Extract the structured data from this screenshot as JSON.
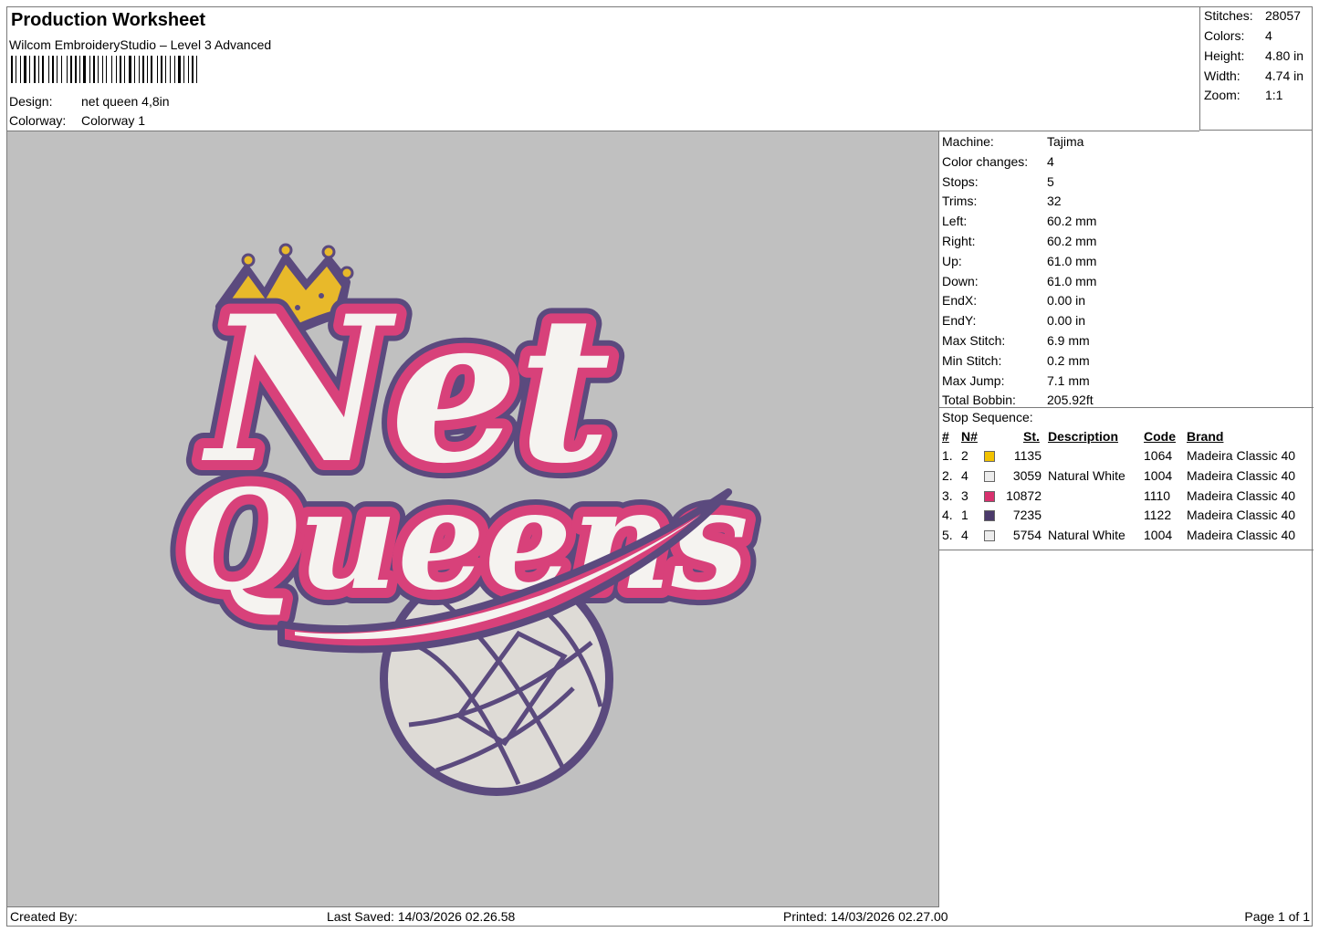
{
  "header": {
    "title": "Production Worksheet",
    "software": "Wilcom EmbroideryStudio – Level 3 Advanced",
    "design_label": "Design:",
    "design_value": "net queen 4,8in",
    "colorway_label": "Colorway:",
    "colorway_value": "Colorway 1"
  },
  "stats": [
    {
      "label": "Stitches:",
      "value": "28057"
    },
    {
      "label": "Colors:",
      "value": "4"
    },
    {
      "label": "Height:",
      "value": "4.80 in"
    },
    {
      "label": "Width:",
      "value": "4.74 in"
    },
    {
      "label": "Zoom:",
      "value": "1:1"
    }
  ],
  "machine_info": [
    {
      "label": "Machine:",
      "value": "Tajima"
    },
    {
      "label": "Color changes:",
      "value": "4"
    },
    {
      "label": "Stops:",
      "value": "5"
    },
    {
      "label": "Trims:",
      "value": "32"
    },
    {
      "label": "Left:",
      "value": "60.2 mm"
    },
    {
      "label": "Right:",
      "value": "60.2 mm"
    },
    {
      "label": "Up:",
      "value": "61.0 mm"
    },
    {
      "label": "Down:",
      "value": "61.0 mm"
    },
    {
      "label": "EndX:",
      "value": "0.00 in"
    },
    {
      "label": "EndY:",
      "value": "0.00 in"
    },
    {
      "label": "Max Stitch:",
      "value": "6.9 mm"
    },
    {
      "label": "Min Stitch:",
      "value": "0.2 mm"
    },
    {
      "label": "Max Jump:",
      "value": "7.1 mm"
    },
    {
      "label": "Total Bobbin:",
      "value": "205.92ft"
    }
  ],
  "stop_sequence": {
    "title": "Stop Sequence:",
    "headers": {
      "num": "#",
      "n": "N#",
      "st": "St.",
      "desc": "Description",
      "code": "Code",
      "brand": "Brand"
    },
    "rows": [
      {
        "idx": "1.",
        "n": "2",
        "color": "#f2c200",
        "st": "1135",
        "desc": "",
        "code": "1064",
        "brand": "Madeira Classic 40"
      },
      {
        "idx": "2.",
        "n": "4",
        "color": "#ececec",
        "st": "3059",
        "desc": "Natural White",
        "code": "1004",
        "brand": "Madeira Classic 40"
      },
      {
        "idx": "3.",
        "n": "3",
        "color": "#d8316e",
        "st": "10872",
        "desc": "",
        "code": "1110",
        "brand": "Madeira Classic 40"
      },
      {
        "idx": "4.",
        "n": "1",
        "color": "#4b3a6b",
        "st": "7235",
        "desc": "",
        "code": "1122",
        "brand": "Madeira Classic 40"
      },
      {
        "idx": "5.",
        "n": "4",
        "color": "#ececec",
        "st": "5754",
        "desc": "Natural White",
        "code": "1004",
        "brand": "Madeira Classic 40"
      }
    ]
  },
  "preview": {
    "line1": "Net",
    "line2": "Queens",
    "colors": {
      "background": "#c0c0c0",
      "gold": "#e8b92a",
      "white": "#f5f3f0",
      "pink": "#d8417a",
      "purple": "#5b4a7e",
      "ball": "#dedbd6"
    }
  },
  "footer": {
    "created_by": "Created By:",
    "last_saved": "Last Saved: 14/03/2026 02.26.58",
    "printed": "Printed: 14/03/2026 02.27.00",
    "page": "Page 1 of 1"
  }
}
